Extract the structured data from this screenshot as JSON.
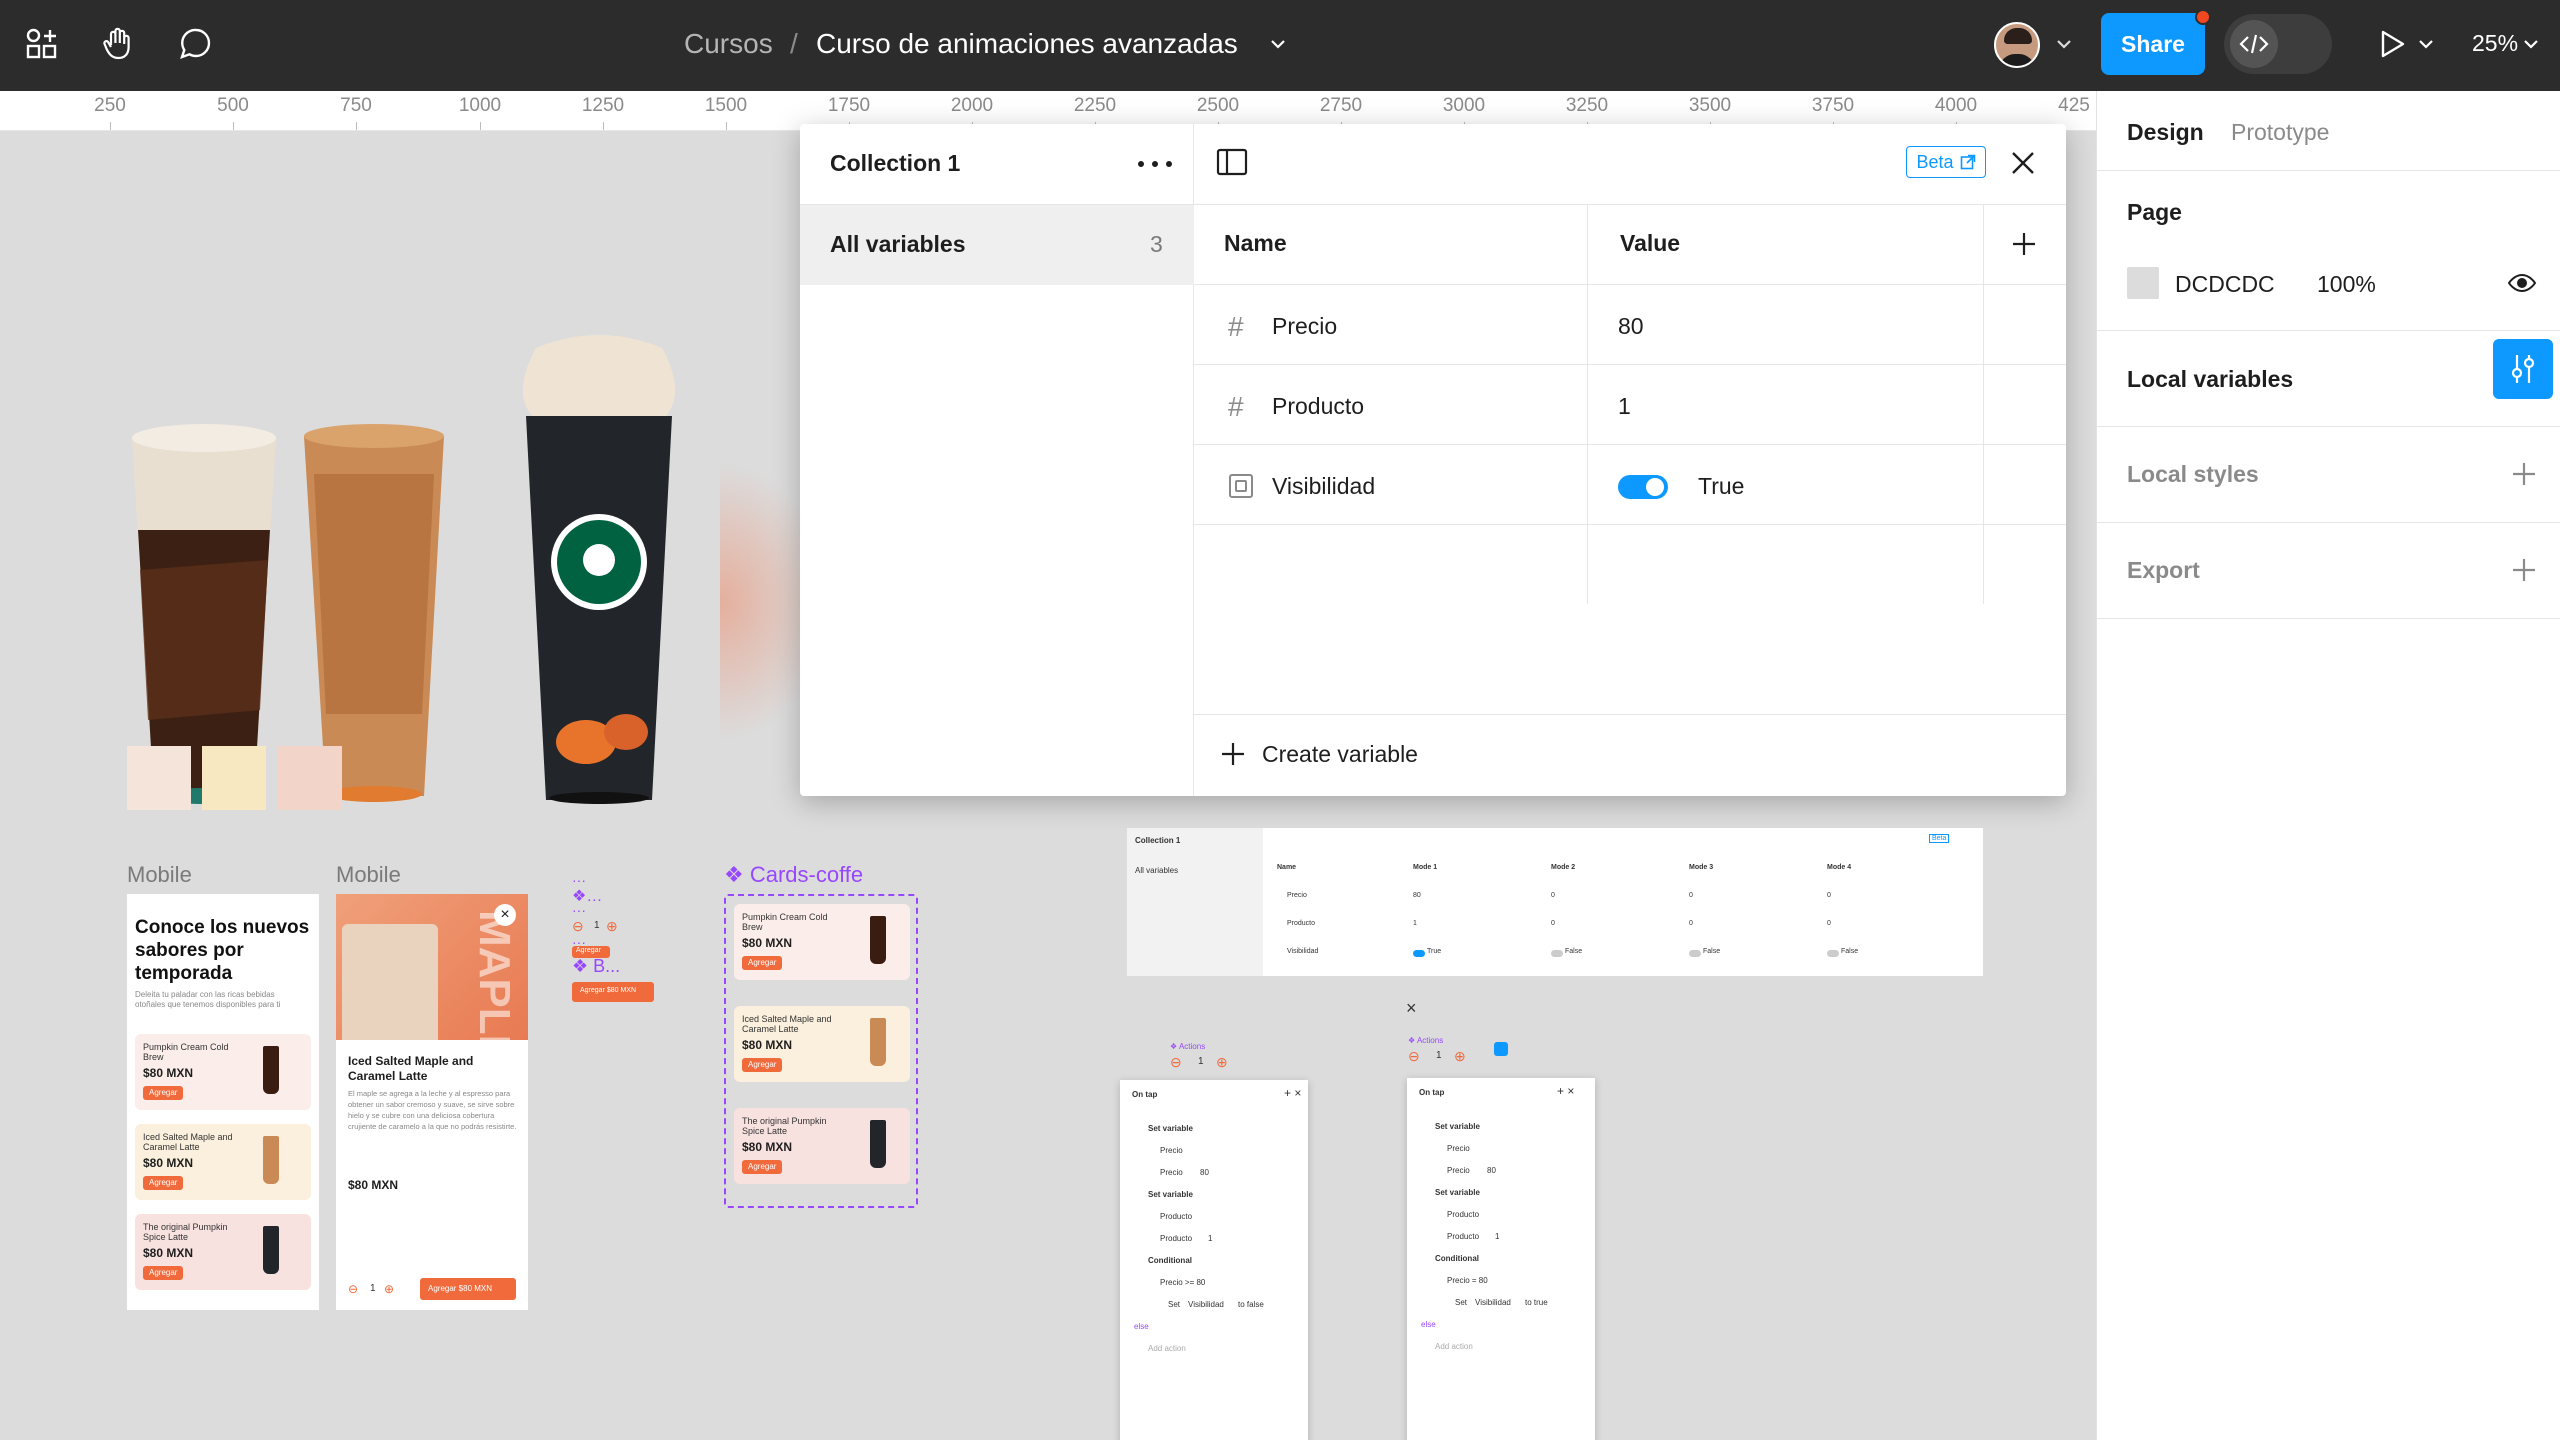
{
  "topbar": {
    "breadcrumb_parent": "Cursos",
    "breadcrumb_sep": "/",
    "file_name": "Curso de animaciones avanzadas",
    "share_label": "Share",
    "zoom": "25%"
  },
  "ruler": {
    "ticks": [
      "250",
      "500",
      "750",
      "1000",
      "1250",
      "1500",
      "1750",
      "2000",
      "2250",
      "2500",
      "2750",
      "3000",
      "3250",
      "3500",
      "3750",
      "4000",
      "425"
    ]
  },
  "modal": {
    "collection_title": "Collection 1",
    "all_variables_label": "All variables",
    "all_variables_count": "3",
    "beta_label": "Beta",
    "col_name": "Name",
    "col_value": "Value",
    "rows": [
      {
        "name": "Precio",
        "value": "80",
        "type": "number"
      },
      {
        "name": "Producto",
        "value": "1",
        "type": "number"
      },
      {
        "name": "Visibilidad",
        "value": "True",
        "type": "boolean"
      }
    ],
    "create_label": "Create variable"
  },
  "right_panel": {
    "tab_design": "Design",
    "tab_prototype": "Prototype",
    "page_title": "Page",
    "page_color": "DCDCDC",
    "page_opacity": "100%",
    "local_variables": "Local variables",
    "local_styles": "Local styles",
    "export": "Export"
  },
  "canvas": {
    "frame1_label": "Mobile",
    "frame2_label": "Mobile",
    "cards_label": "Cards-coffe",
    "frame1_heading": "Conoce los nuevos sabores por temporada",
    "frame1_sub": "Deleita tu paladar con las ricas bebidas otoñales que tenemos disponibles para ti",
    "products": [
      {
        "name": "Pumpkin Cream Cold Brew",
        "price": "$80 MXN"
      },
      {
        "name": "Iced Salted Maple and Caramel Latte",
        "price": "$80 MXN"
      },
      {
        "name": "The original Pumpkin Spice Latte",
        "price": "$80 MXN"
      }
    ],
    "add_label": "Agregar",
    "frame2_title": "Iced Salted Maple and Caramel Latte",
    "frame2_body": "El maple se agrega a la leche y al espresso para obtener un sabor cremoso y suave, se sirve sobre hielo y se cubre con una deliciosa cobertura crujiente de caramelo a la que no podrás resistirte.",
    "frame2_price": "$80 MXN",
    "frame2_qty": "1",
    "frame2_add": "Agregar $80 MXN",
    "comp_qty": "1",
    "comp_agregar": "Agregar",
    "comp_agregar_price": "Agregar $80 MXN",
    "comp_b_label": "B...",
    "frame2_vertical_text": "MAPLE",
    "mini_table": {
      "title": "Collection 1",
      "all": "All variables",
      "beta": "Beta",
      "headers": [
        "Name",
        "Mode 1",
        "Mode 2",
        "Mode 3",
        "Mode 4"
      ],
      "rows": [
        [
          "Precio",
          "80",
          "0",
          "0",
          "0"
        ],
        [
          "Producto",
          "1",
          "0",
          "0",
          "0"
        ],
        [
          "Visibilidad",
          "True",
          "False",
          "False",
          "False"
        ]
      ]
    },
    "proto_panels": [
      {
        "title": "On tap",
        "action1": "Set variable",
        "v1": "Precio",
        "v2": "Precio",
        "val": "80",
        "action2": "Set variable",
        "v3": "Producto",
        "v4": "Producto",
        "val2": "1",
        "cond": "Conditional",
        "expr": "Precio >= 80",
        "set": "Set",
        "var": "Visibilidad",
        "to": "to false",
        "else": "else",
        "add": "Add action"
      },
      {
        "title": "On tap",
        "action1": "Set variable",
        "v1": "Precio",
        "v2": "Precio",
        "val": "80",
        "action2": "Set variable",
        "v3": "Producto",
        "v4": "Producto",
        "val2": "1",
        "cond": "Conditional",
        "expr": "Precio = 80",
        "set": "Set",
        "var": "Visibilidad",
        "to": "to true",
        "else": "else",
        "add": "Add action"
      }
    ],
    "actions_label": "Actions",
    "actions_qty": "1"
  },
  "colors": {
    "accent": "#0d99ff",
    "share": "#0d99ff",
    "topbar": "#2c2c2c",
    "canvas": "#dcdcdc",
    "brand_orange": "#f06a3c",
    "component_purple": "#9747ff"
  }
}
